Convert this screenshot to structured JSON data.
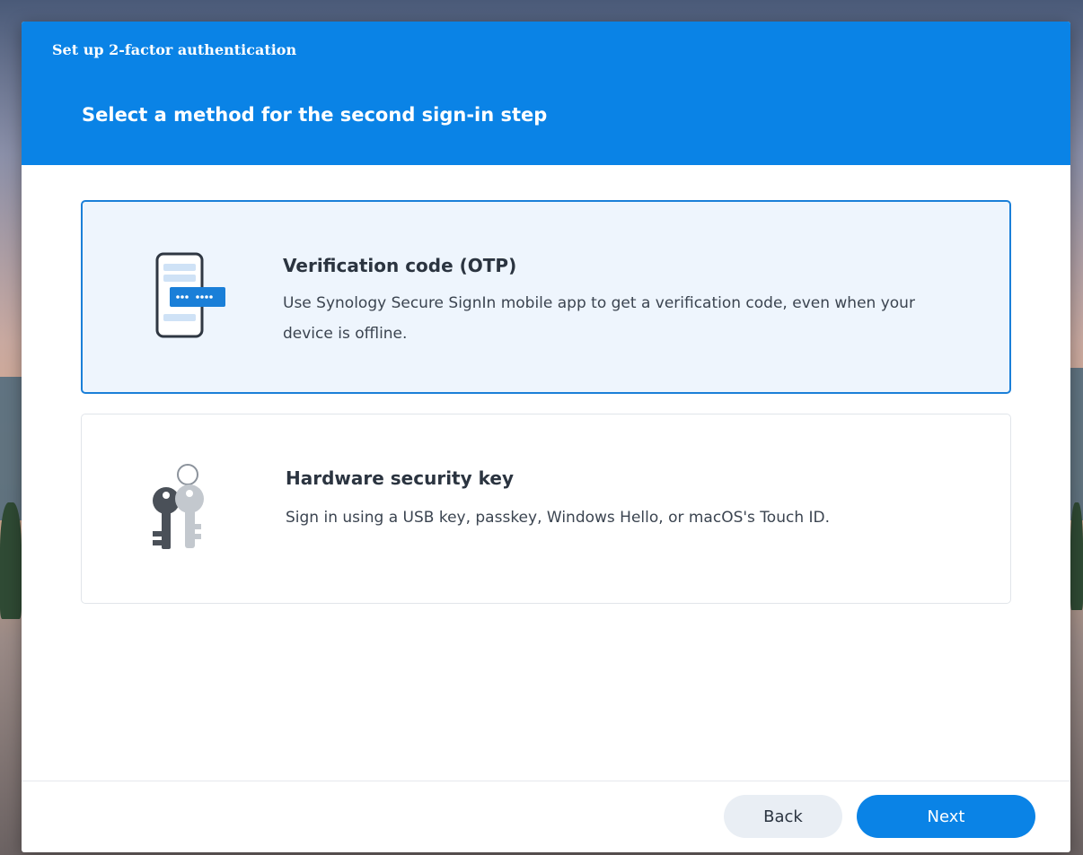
{
  "dialog": {
    "title": "Set up 2-factor authentication",
    "heading": "Select a method for the second sign-in step"
  },
  "options": [
    {
      "title": "Verification code (OTP)",
      "description": "Use Synology Secure SignIn mobile app to get a verification code, even when your device is offline.",
      "icon": "phone-otp-icon",
      "selected": true
    },
    {
      "title": "Hardware security key",
      "description": "Sign in using a USB key, passkey, Windows Hello, or macOS's Touch ID.",
      "icon": "keys-icon",
      "selected": false
    }
  ],
  "footer": {
    "back_label": "Back",
    "next_label": "Next"
  },
  "colors": {
    "accent": "#0a83e6",
    "selected_border": "#1a7fd8",
    "selected_bg": "#eef5fd"
  }
}
